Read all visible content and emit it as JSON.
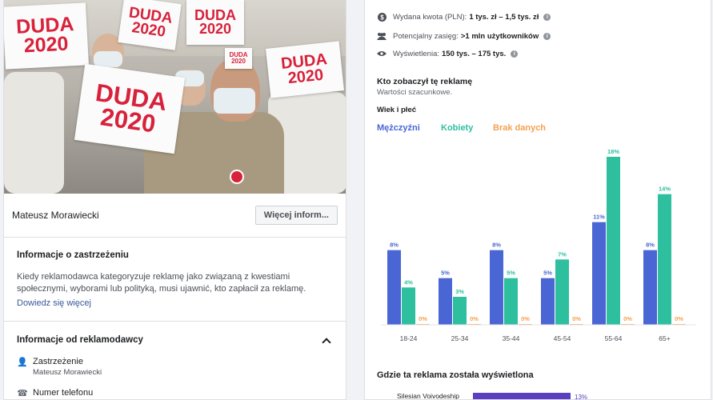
{
  "left": {
    "photo_signs": [
      {
        "line1": "DUDA",
        "line2": "2020"
      },
      {
        "line1": "DUDA",
        "line2": "2020"
      },
      {
        "line1": "DUDA",
        "line2": "2020"
      },
      {
        "line1": "DUDA",
        "line2": "2020"
      },
      {
        "line1": "DUDA",
        "line2": "2020"
      },
      {
        "line1": "DUDA",
        "line2": "2020"
      }
    ],
    "advertiser_name": "Mateusz Morawiecki",
    "more_button": "Więcej inform...",
    "disclaimer": {
      "title": "Informacje o zastrzeżeniu",
      "body": "Kiedy reklamodawca kategoryzuje reklamę jako związaną z kwestiami społecznymi, wyborami lub polityką, musi ujawnić, kto zapłacił za reklamę.",
      "link": "Dowiedz się więcej"
    },
    "advertiser_info": {
      "title": "Informacje od reklamodawcy",
      "items": [
        {
          "icon": "person-icon",
          "label": "Zastrzeżenie",
          "value": "Mateusz Morawiecki"
        },
        {
          "icon": "phone-icon",
          "label": "Numer telefonu",
          "value": ""
        }
      ]
    }
  },
  "right": {
    "stats": [
      {
        "icon": "dollar-icon",
        "label": "Wydana kwota (PLN):",
        "value": "1 tys. zł – 1,5 tys. zł"
      },
      {
        "icon": "people-icon",
        "label": "Potencjalny zasięg:",
        "value": ">1 mln użytkowników"
      },
      {
        "icon": "eye-icon",
        "label": "Wyświetlenia:",
        "value": "150 tys. – 175 tys."
      }
    ],
    "who_title": "Kto zobaczył tę reklamę",
    "who_subtitle": "Wartości szacunkowe.",
    "age_gender_title": "Wiek i płeć",
    "where_title": "Gdzie ta reklama została wyświetlona",
    "where_items": [
      {
        "label": "Silesian Voivodeship",
        "value": "13%"
      }
    ]
  },
  "chart_data": {
    "type": "bar",
    "title": "Wiek i płeć",
    "categories": [
      "18-24",
      "25-34",
      "35-44",
      "45-54",
      "55-64",
      "65+"
    ],
    "series": [
      {
        "name": "Mężczyźni",
        "color": "#4a66d4",
        "values": [
          8,
          5,
          8,
          5,
          11,
          8
        ],
        "labels": [
          "8%",
          "5%",
          "8%",
          "5%",
          "11%",
          "8%"
        ]
      },
      {
        "name": "Kobiety",
        "color": "#2ebf9f",
        "values": [
          4,
          3,
          5,
          7,
          18,
          14
        ],
        "labels": [
          "4%",
          "3%",
          "5%",
          "7%",
          "18%",
          "14%"
        ]
      },
      {
        "name": "Brak danych",
        "color": "#f5a050",
        "values": [
          0,
          0,
          0,
          0,
          0,
          0
        ],
        "labels": [
          "0%",
          "0%",
          "0%",
          "0%",
          "0%",
          "0%"
        ]
      }
    ],
    "ylim": [
      0,
      18
    ],
    "legend": "top-left"
  }
}
